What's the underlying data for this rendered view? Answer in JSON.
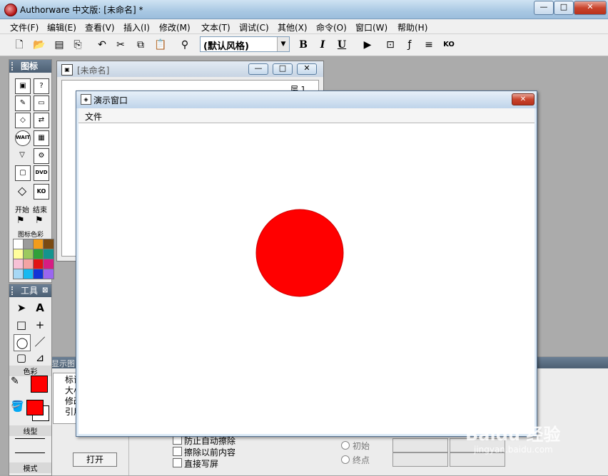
{
  "app": {
    "title": "Authorware 中文版: [未命名] *",
    "window_buttons": {
      "minimize": "—",
      "maximize": "□",
      "close": "✕"
    }
  },
  "menu": [
    "文件(F)",
    "编辑(E)",
    "查看(V)",
    "插入(I)",
    "修改(M)",
    "文本(T)",
    "调试(C)",
    "其他(X)",
    "命令(O)",
    "窗口(W)",
    "帮助(H)"
  ],
  "toolbar": {
    "style_value": "(默认风格)",
    "bold": "B",
    "italic": "I",
    "underline": "U"
  },
  "icon_palette": {
    "title": "图标",
    "start_label": "开始",
    "end_label": "结束",
    "color_label": "图标色彩",
    "colors": [
      "#ffffff",
      "#9b9b9b",
      "#f29c1c",
      "#7a4a12",
      "#fffe9c",
      "#9cc95f",
      "#30a03a",
      "#13948e",
      "#f7c1d6",
      "#f3a3a3",
      "#e11414",
      "#d61d83",
      "#a7d8f5",
      "#16b9f1",
      "#1233d6",
      "#9a66f0"
    ]
  },
  "tools_palette": {
    "title": "工具",
    "color_label": "色彩",
    "line_label": "线型",
    "mode_label": "模式",
    "text_tool_glyph": "A",
    "fill_color": "#ff0000",
    "line_color": "#ff0000"
  },
  "flow_window": {
    "title": "[未命名]",
    "level_label": "层 1"
  },
  "props": {
    "left_labels": [
      "标识",
      "大小",
      "修改",
      "引用"
    ],
    "left_title": "显示图",
    "checkboxes": [
      "防止自动擦除",
      "擦除以前内容",
      "直接写屏"
    ],
    "open_button": "打开",
    "radios": [
      "初始",
      "终点"
    ]
  },
  "presentation": {
    "title": "演示窗口",
    "menu_file": "文件",
    "circle_color": "#ff0000"
  },
  "watermark": {
    "line1": "Baidu 经验",
    "line2": "jingyan.baidu.com"
  }
}
